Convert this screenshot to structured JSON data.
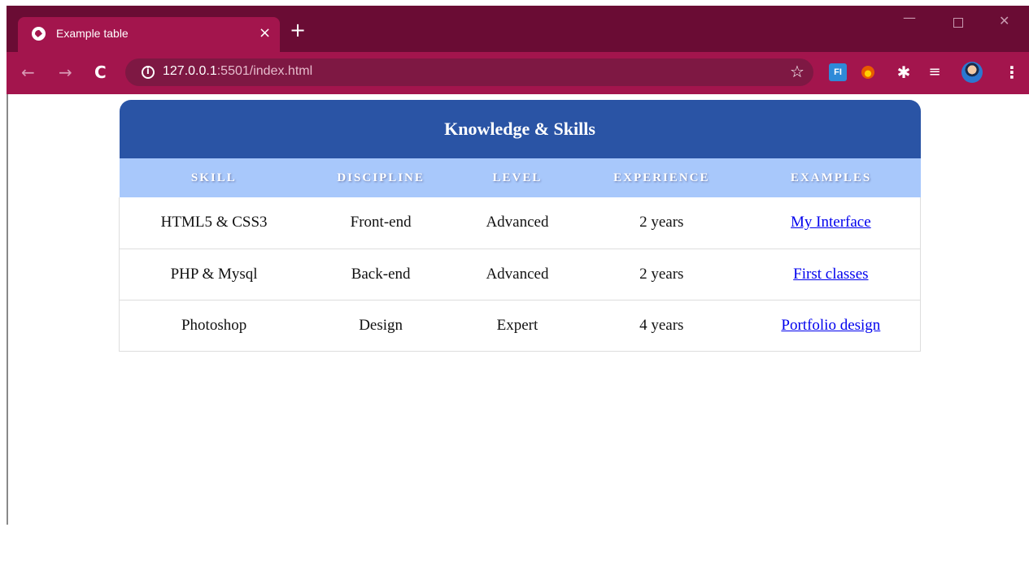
{
  "browser": {
    "tab_title": "Example table",
    "tab_close": "×",
    "new_tab": "+",
    "window_minimize": "—",
    "window_close": "✕",
    "nav_back": "←",
    "nav_forward": "→",
    "nav_reload": "C",
    "url_host": "127.0.0.1",
    "url_rest": ":5501/index.html",
    "bookmark_icon": "star-icon",
    "extensions": [
      "FI",
      "fire-extension",
      "puzzle-icon",
      "media-control-icon"
    ],
    "menu": "⋮",
    "colors": {
      "frame": "#6a0c34",
      "tab": "#a3154d",
      "omnibox": "#7e1843"
    }
  },
  "table": {
    "caption": "Knowledge & Skills",
    "columns": [
      "SKILL",
      "DISCIPLINE",
      "LEVEL",
      "EXPERIENCE",
      "EXAMPLES"
    ],
    "rows": [
      {
        "skill": "HTML5 & CSS3",
        "discipline": "Front-end",
        "level": "Advanced",
        "experience": "2 years",
        "example": "My Interface"
      },
      {
        "skill": "PHP & Mysql",
        "discipline": "Back-end",
        "level": "Advanced",
        "experience": "2 years",
        "example": "First classes"
      },
      {
        "skill": "Photoshop",
        "discipline": "Design",
        "level": "Expert",
        "experience": "4 years",
        "example": "Portfolio design"
      }
    ],
    "colors": {
      "caption_bg": "#2a54a5",
      "header_bg": "#a8c8fb",
      "link": "#0000ee"
    }
  }
}
